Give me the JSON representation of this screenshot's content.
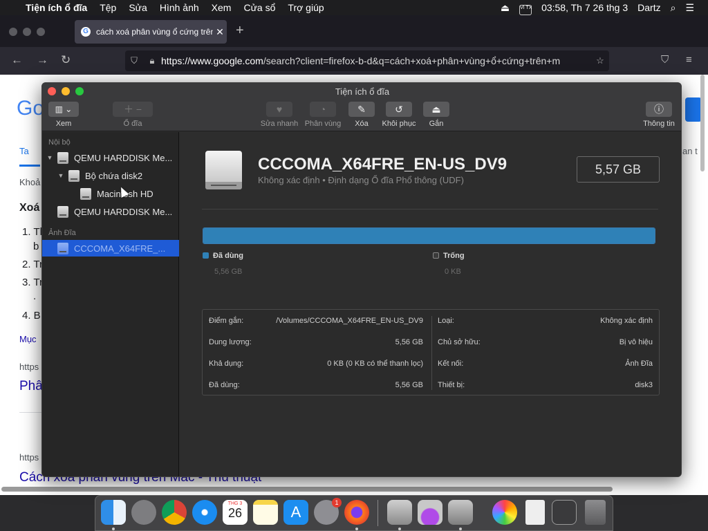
{
  "menubar": {
    "apple": "",
    "app_name": "Tiện ích ổ đĩa",
    "items": [
      "Tệp",
      "Sửa",
      "Hình ảnh",
      "Xem",
      "Cửa sổ",
      "Trợ giúp"
    ],
    "input_badge": "VI TX",
    "clock": "03:58, Th 7 26 thg 3",
    "user": "Dartz"
  },
  "browser": {
    "tab_title": "cách xoá phân vùng ổ cứng trên",
    "tab_favicon": "G",
    "url_domain": "https://www.google.com",
    "url_rest": "/search?client=firefox-b-d&q=cách+xoá+phân+vùng+ổ+cứng+trên+m",
    "colors": {
      "tabbar": "#1c1b22",
      "navbar": "#2b2a33"
    }
  },
  "webpage": {
    "logo_fragment": "Go",
    "tab_fragment": "Ta",
    "right_fragment": "an t",
    "crumb_fragment": "Khoả",
    "heading_fragment": "Xoá",
    "list_fragments": [
      "1. Th",
      "b",
      "2. Tr",
      "3. Tr",
      ".",
      "4. B"
    ],
    "more_fragment": "Mục",
    "url1_fragment": "https",
    "link1_fragment": "Phâ",
    "url2_fragment": "https",
    "link2": "Cách xoá phân vùng trên Mac - Thủ thuật"
  },
  "disk_utility": {
    "window_title": "Tiện ích ổ đĩa",
    "toolbar": {
      "view_label": "Xem",
      "volume_label": "Ổ đĩa",
      "first_aid_label": "Sửa nhanh",
      "partition_label": "Phân vùng",
      "erase_label": "Xóa",
      "restore_label": "Khôi phục",
      "mount_label": "Gắn",
      "info_label": "Thông tin"
    },
    "sidebar": {
      "internal_header": "Nội bộ",
      "items": [
        {
          "label": "QEMU HARDDISK Me..."
        },
        {
          "label": "Bộ chứa disk2"
        },
        {
          "label": "Macintosh HD"
        },
        {
          "label": "QEMU HARDDISK Me..."
        }
      ],
      "images_header": "Ảnh Đĩa",
      "selected_item": "CCCOMA_X64FRE_..."
    },
    "volume": {
      "name": "CCCOMA_X64FRE_EN-US_DV9",
      "subtitle": "Không xác định • Định dạng Ổ đĩa Phổ thông (UDF)",
      "size": "5,57 GB",
      "used_fraction": 1.0,
      "used_label": "Đã dùng",
      "used_value": "5,56 GB",
      "free_label": "Trống",
      "free_value": "0 KB",
      "used_color": "#2f81b7",
      "free_color": "#3a3a3a"
    },
    "info": {
      "left": [
        {
          "key": "Điểm gắn:",
          "value": "/Volumes/CCCOMA_X64FRE_EN-US_DV9"
        },
        {
          "key": "Dung lượng:",
          "value": "5,56 GB"
        },
        {
          "key": "Khả dụng:",
          "value": "0 KB (0 KB có thể thanh lọc)"
        },
        {
          "key": "Đã dùng:",
          "value": "5,56 GB"
        }
      ],
      "right": [
        {
          "key": "Loại:",
          "value": "Không xác định"
        },
        {
          "key": "Chủ sở hữu:",
          "value": "Bị vô hiệu"
        },
        {
          "key": "Kết nối:",
          "value": "Ảnh Đĩa"
        },
        {
          "key": "Thiết bị:",
          "value": "disk3"
        }
      ]
    }
  },
  "dock": {
    "calendar_month": "THG 3",
    "calendar_day": "26",
    "settings_badge": "1",
    "items": [
      "finder-icon",
      "launchpad-icon",
      "chrome-icon",
      "safari-icon",
      "calendar-icon",
      "notes-icon",
      "app-store-icon",
      "system-preferences-icon",
      "firefox-icon",
      "disk-utility-icon",
      "installer-icon",
      "disk-utility-2-icon",
      "photos-icon",
      "document-icon",
      "screenshot-icon",
      "trash-icon"
    ]
  }
}
